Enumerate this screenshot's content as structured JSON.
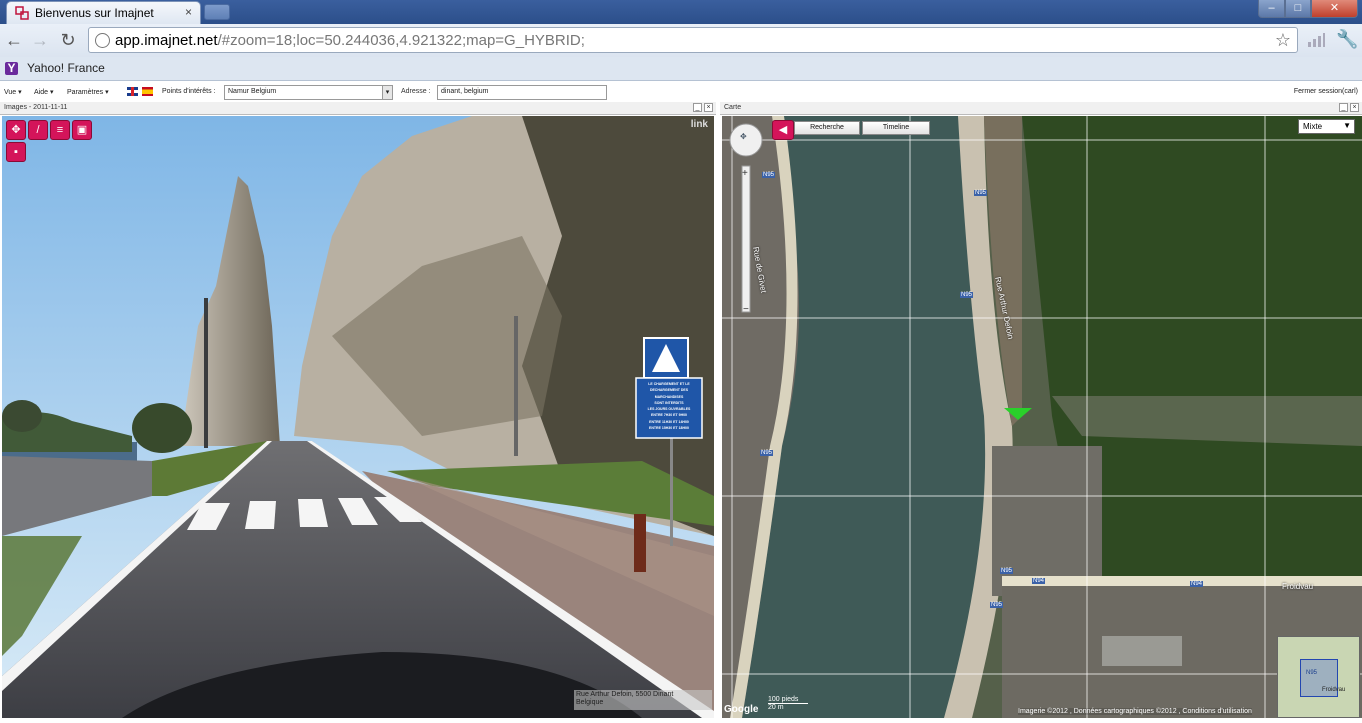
{
  "browser": {
    "tab_title": "Bienvenus sur Imajnet",
    "tab_close": "×",
    "url_host": "app.imajnet.net",
    "url_path": "/#zoom=18;loc=50.244036,4.921322;map=G_HYBRID;",
    "bookmark": "Yahoo! France",
    "bookmark_icon": "Y"
  },
  "menu": {
    "vue": "Vue ▾",
    "aide": "Aide ▾",
    "params": "Paramètres ▾",
    "poi_label": "Points d'intérêts :",
    "poi_value": "Namur Belgium",
    "addr_label": "Adresse :",
    "addr_value": "dinant, belgium",
    "logout": "Fermer session(carl)"
  },
  "images_panel": {
    "title": "Images - 2011-11-11",
    "logo": "link",
    "caption_line1": "Rue Arthur Defoin, 5500 Dinant",
    "caption_line2": "Belgique",
    "sign_text": [
      "LE CHARGEMENT ET LE",
      "DECHARGEMENT DES",
      "MARCHANDISES",
      "SONT INTERDITS",
      "LES JOURS OUVRABLES",
      "ENTRE 7H30 ET 9H00",
      "ENTRE 11H30 ET 14H00",
      "ENTRE 15H30 ET 18H00"
    ]
  },
  "map_panel": {
    "title": "Carte",
    "search_button": "Recherche",
    "timeline_button": "Timeline",
    "map_type": "Mixte",
    "scale_top": "100 pieds",
    "scale_bottom": "20 m",
    "google": "Google",
    "copyright": "Imagerie ©2012 , Données cartographiques ©2012 ,  Conditions d'utilisation",
    "labels": {
      "rue_de_givet": "Rue de Givet",
      "rue_arthur_defoin": "Rue Arthur Defoin",
      "froidvau": "Froidvau",
      "mini_froidvau": "Froidvau",
      "mini_n95": "N95"
    },
    "road_tags": [
      "N95",
      "N95",
      "N95",
      "N95",
      "N95",
      "N95",
      "N94",
      "N94"
    ]
  },
  "colors": {
    "accent": "#d4145a",
    "chrome": "#2c4f8a"
  }
}
